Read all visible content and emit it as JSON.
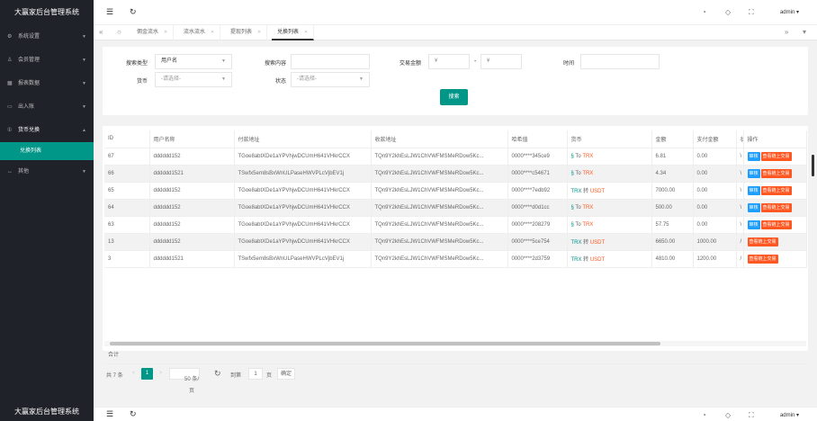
{
  "app": {
    "title": "大赢家后台管理系统"
  },
  "sidebar": {
    "items": [
      {
        "icon": "⚙",
        "label": "系统设置"
      },
      {
        "icon": "♙",
        "label": "会员管理"
      },
      {
        "icon": "▦",
        "label": "报表数据"
      },
      {
        "icon": "▭",
        "label": "出入账"
      },
      {
        "icon": "①",
        "label": "货币兑换"
      }
    ],
    "active_sub": "兑换列表",
    "last_item": {
      "icon": "↔",
      "label": "其他"
    }
  },
  "topbar": {
    "user": "admin"
  },
  "tabs": [
    {
      "label": "佣金流水"
    },
    {
      "label": "流水流水"
    },
    {
      "label": "提现列表"
    },
    {
      "label": "兑换列表"
    }
  ],
  "search": {
    "type_label": "搜索类型",
    "type_value": "用户名",
    "content_label": "搜索内容",
    "content_value": "",
    "amount_label": "交易金额",
    "amount_min_ph": "¥",
    "amount_sep": "-",
    "amount_max_ph": "¥",
    "time_label": "时间",
    "time_value": "",
    "currency_label": "货币",
    "currency_ph": "-请选择-",
    "status_label": "状态",
    "status_ph": "-请选择-",
    "button": "搜索"
  },
  "table": {
    "headers": [
      "ID",
      "用户名称",
      "付款地址",
      "收款地址",
      "哈希值",
      "货币",
      "金额",
      "支付金额",
      "状",
      "操作"
    ],
    "rows": [
      {
        "id": "67",
        "user": "dddddd152",
        "from": "TGoe8abtXDe1aYPVhjwDCUmH641VHkrCCX",
        "to": "TQn9Y2khEsLJW1ChVWFMSMeRDow5Kc...",
        "hash": "0000****345ce9",
        "cur_a": "§",
        "cur_to": " To ",
        "cur_b": "TRX",
        "amount": "6.81",
        "paid": "0.00",
        "st": "\\",
        "ops": [
          "审核",
          "查看链上交易"
        ]
      },
      {
        "id": "66",
        "user": "dddddd1521",
        "from": "TSwfx5em8sBxWnULPaseHWVPLcVjbEV1j",
        "to": "TQn9Y2khEsLJW1ChVWFMSMeRDow5Kc...",
        "hash": "0000****c54671",
        "cur_a": "§",
        "cur_to": " To ",
        "cur_b": "TRX",
        "amount": "4.34",
        "paid": "0.00",
        "st": "\\",
        "ops": [
          "审核",
          "查看链上交易"
        ]
      },
      {
        "id": "65",
        "user": "dddddd152",
        "from": "TGoe8abtXDe1aYPVhjwDCUmH641VHkrCCX",
        "to": "TQn9Y2khEsLJW1ChVWFMSMeRDow5Kc...",
        "hash": "0000****7edb92",
        "cur_a": "TRX",
        "cur_to": " 转 ",
        "cur_b": "USDT",
        "amount": "7000.00",
        "paid": "0.00",
        "st": "\\",
        "ops": [
          "审核",
          "查看链上交易"
        ]
      },
      {
        "id": "64",
        "user": "dddddd152",
        "from": "TGoe8abtXDe1aYPVhjwDCUmH641VHkrCCX",
        "to": "TQn9Y2khEsLJW1ChVWFMSMeRDow5Kc...",
        "hash": "0000****d0d1cc",
        "cur_a": "§",
        "cur_to": " To ",
        "cur_b": "TRX",
        "amount": "500.00",
        "paid": "0.00",
        "st": "\\",
        "ops": [
          "审核",
          "查看链上交易"
        ]
      },
      {
        "id": "63",
        "user": "dddddd152",
        "from": "TGoe8abtXDe1aYPVhjwDCUmH641VHkrCCX",
        "to": "TQn9Y2khEsLJW1ChVWFMSMeRDow5Kc...",
        "hash": "0000****208279",
        "cur_a": "§",
        "cur_to": " To ",
        "cur_b": "TRX",
        "amount": "57.75",
        "paid": "0.00",
        "st": "\\",
        "ops": [
          "审核",
          "查看链上交易"
        ]
      },
      {
        "id": "13",
        "user": "dddddd152",
        "from": "TGoe8abtXDe1aYPVhjwDCUmH641VHkrCCX",
        "to": "TQn9Y2khEsLJW1ChVWFMSMeRDow5Kc...",
        "hash": "0000****5ce754",
        "cur_a": "TRX",
        "cur_to": " 转 ",
        "cur_b": "USDT",
        "amount": "6650.00",
        "paid": "1000.00",
        "st": "/",
        "ops": [
          "查看链上交易"
        ]
      },
      {
        "id": "3",
        "user": "dddddd1521",
        "from": "TSwfx5em8sBxWnULPaseHWVPLcVjbEV1j",
        "to": "TQn9Y2khEsLJW1ChVWFMSMeRDow5Kc...",
        "hash": "0000****2d3759",
        "cur_a": "TRX",
        "cur_to": " 转 ",
        "cur_b": "USDT",
        "amount": "4810.00",
        "paid": "1200.00",
        "st": "/",
        "ops": [
          "查看链上交易"
        ]
      }
    ],
    "sum_label": "合计"
  },
  "pager": {
    "total": "共 7 条",
    "prev": "<",
    "page": "1",
    "next": ">",
    "per_page": "50 条/页",
    "goto_label": "到第",
    "goto_value": "1",
    "goto_unit": "页",
    "confirm": "确定"
  },
  "colors": {
    "accent": "#009688",
    "sidebar_bg": "#20222a",
    "danger": "#ff5722",
    "info": "#1e9fff"
  },
  "icons": {
    "menu": "☰",
    "refresh": "↻",
    "theme": "◔",
    "tag": "◇",
    "fullscreen": "⛶",
    "home": "○",
    "left": "«",
    "right": "»",
    "down": "▾"
  }
}
